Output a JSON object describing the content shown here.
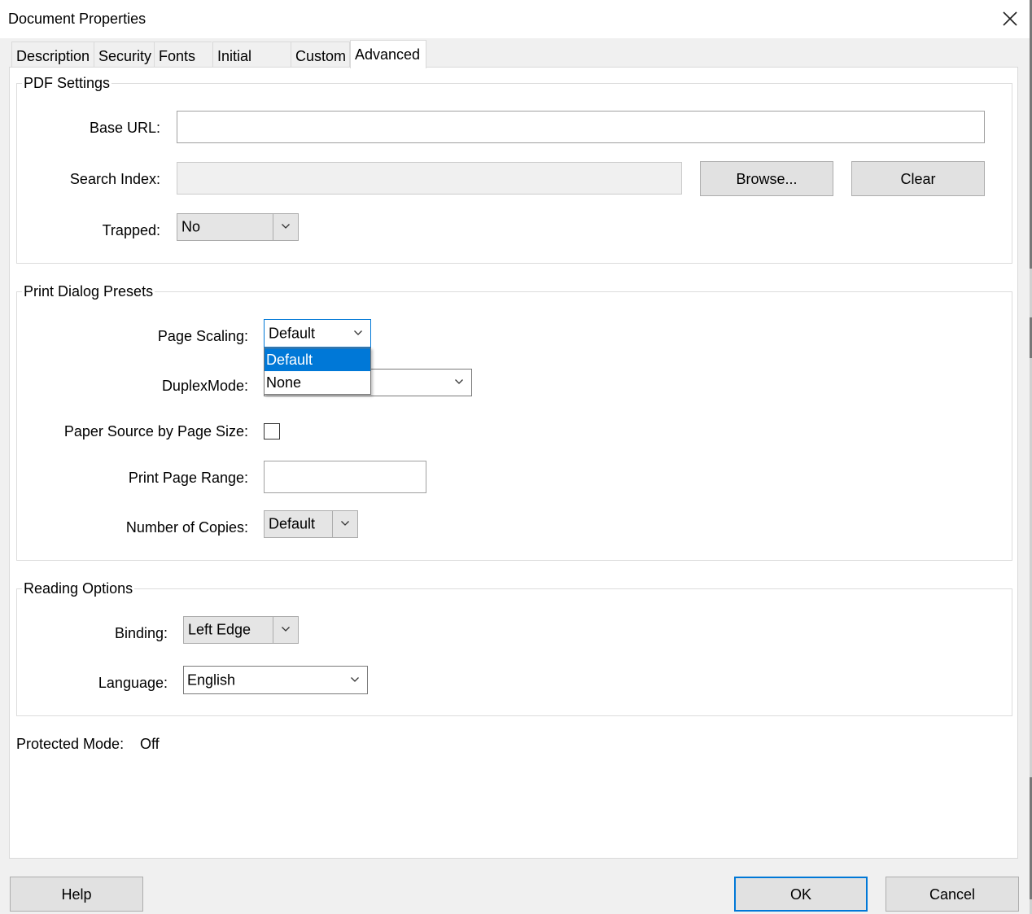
{
  "window": {
    "title": "Document Properties"
  },
  "tabs": [
    {
      "label": "Description"
    },
    {
      "label": "Security"
    },
    {
      "label": "Fonts"
    },
    {
      "label": "Initial View"
    },
    {
      "label": "Custom"
    },
    {
      "label": "Advanced",
      "active": true
    }
  ],
  "pdf_settings": {
    "legend": "PDF Settings",
    "base_url_label": "Base URL:",
    "base_url_value": "",
    "search_index_label": "Search Index:",
    "search_index_value": "",
    "browse_label": "Browse...",
    "clear_label": "Clear",
    "trapped_label": "Trapped:",
    "trapped_value": "No"
  },
  "print_presets": {
    "legend": "Print Dialog Presets",
    "page_scaling_label": "Page Scaling:",
    "page_scaling_value": "Default",
    "page_scaling_options": [
      "Default",
      "None"
    ],
    "duplex_label": "DuplexMode:",
    "paper_source_label": "Paper Source by Page Size:",
    "paper_source_checked": false,
    "print_range_label": "Print Page Range:",
    "print_range_value": "",
    "copies_label": "Number of Copies:",
    "copies_value": "Default"
  },
  "reading_options": {
    "legend": "Reading Options",
    "binding_label": "Binding:",
    "binding_value": "Left Edge",
    "language_label": "Language:",
    "language_value": "English"
  },
  "protected_mode": {
    "label": "Protected Mode:",
    "value": "Off"
  },
  "footer": {
    "help_label": "Help",
    "ok_label": "OK",
    "cancel_label": "Cancel"
  },
  "colors": {
    "accent": "#0078d7",
    "panel": "#ffffff",
    "chrome": "#f0f0f0"
  }
}
